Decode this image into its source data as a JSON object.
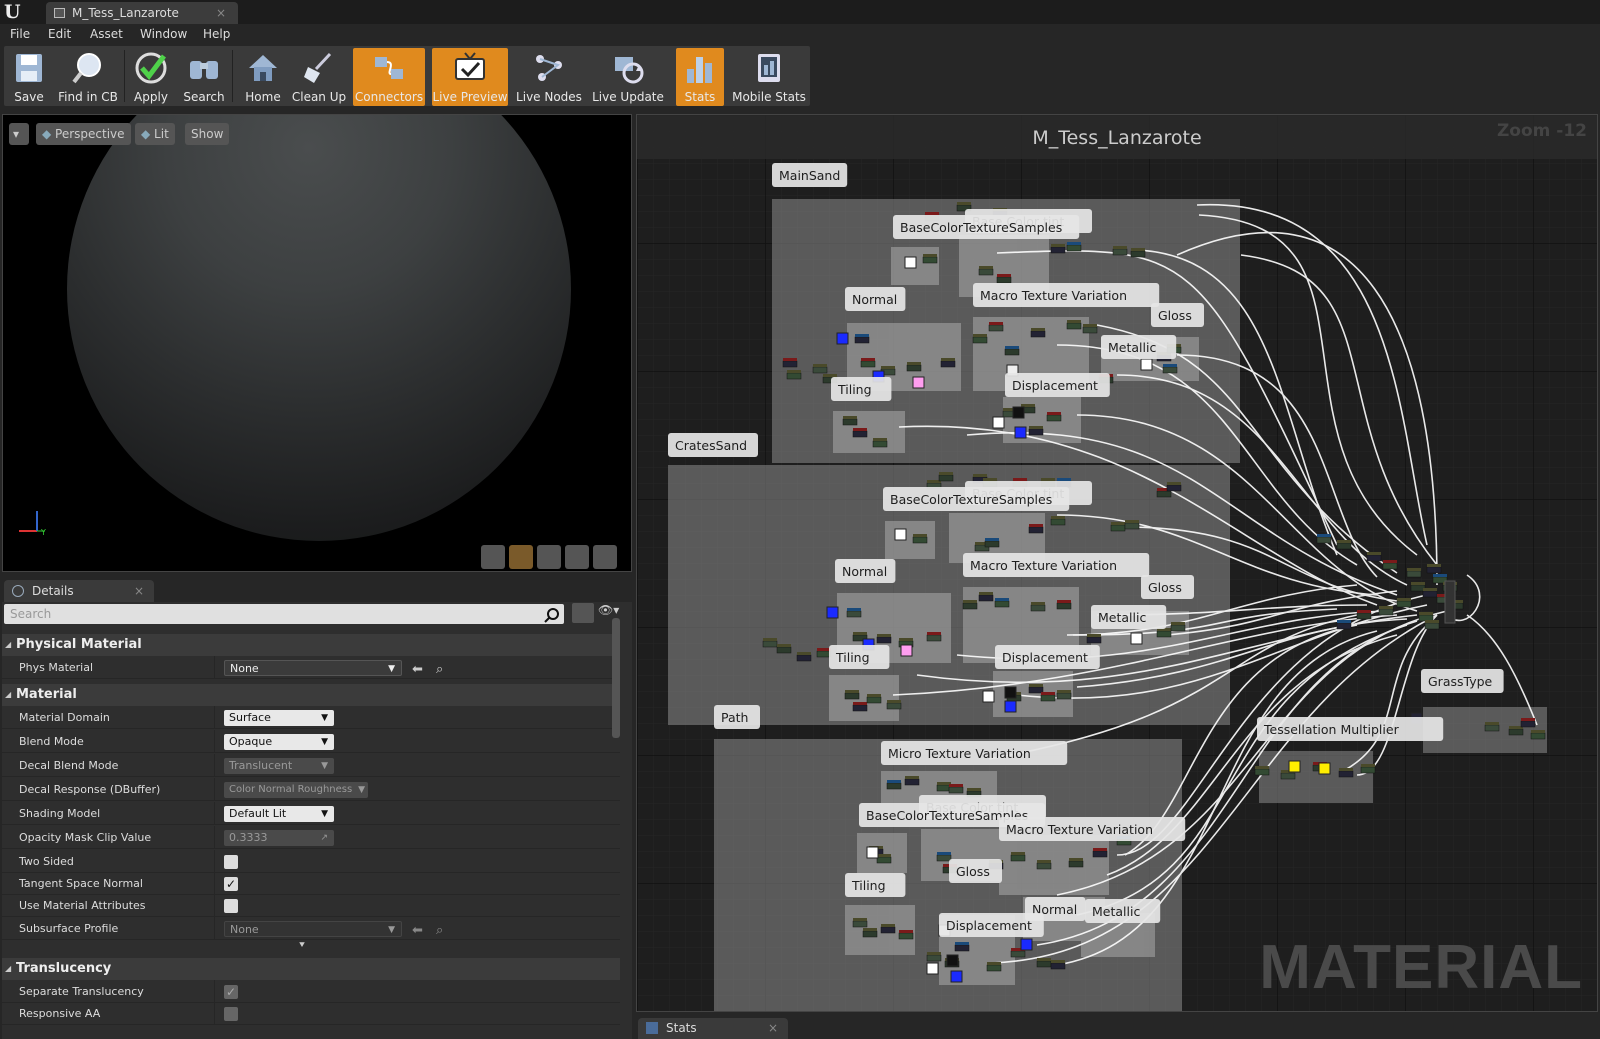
{
  "window": {
    "tab_title": "M_Tess_Lanzarote",
    "tab_close": "×"
  },
  "menu": [
    "File",
    "Edit",
    "Asset",
    "Window",
    "Help"
  ],
  "toolbar": [
    {
      "label": "Save",
      "icon": "save-icon",
      "active": false
    },
    {
      "label": "Find in CB",
      "icon": "magnifier-icon",
      "active": false
    },
    {
      "label": "Apply",
      "icon": "checkmark-icon",
      "active": false
    },
    {
      "label": "Search",
      "icon": "binoculars-icon",
      "active": false
    },
    {
      "label": "Home",
      "icon": "house-icon",
      "active": false
    },
    {
      "label": "Clean Up",
      "icon": "broom-icon",
      "active": false
    },
    {
      "label": "Connectors",
      "icon": "connectors-icon",
      "active": true
    },
    {
      "label": "Live Preview",
      "icon": "tv-icon",
      "active": true
    },
    {
      "label": "Live Nodes",
      "icon": "nodes-icon",
      "active": false
    },
    {
      "label": "Live Update",
      "icon": "refresh-icon",
      "active": false
    },
    {
      "label": "Stats",
      "icon": "bar-chart-icon",
      "active": true
    },
    {
      "label": "Mobile Stats",
      "icon": "mobile-icon",
      "active": false
    }
  ],
  "viewport": {
    "perspective": "Perspective",
    "lit": "Lit",
    "show": "Show"
  },
  "details": {
    "tab_label": "Details",
    "tab_close": "×",
    "search_placeholder": "Search",
    "categories": {
      "physical": "Physical Material",
      "material": "Material",
      "translucency": "Translucency"
    },
    "rows": {
      "phys_material": {
        "label": "Phys Material",
        "value": "None"
      },
      "material_domain": {
        "label": "Material Domain",
        "value": "Surface"
      },
      "blend_mode": {
        "label": "Blend Mode",
        "value": "Opaque"
      },
      "decal_blend_mode": {
        "label": "Decal Blend Mode",
        "value": "Translucent"
      },
      "decal_response": {
        "label": "Decal Response (DBuffer)",
        "value": "Color Normal Roughness"
      },
      "shading_model": {
        "label": "Shading Model",
        "value": "Default Lit"
      },
      "opacity_mask_clip": {
        "label": "Opacity Mask Clip Value",
        "value": "0.3333"
      },
      "two_sided": {
        "label": "Two Sided",
        "checked": false
      },
      "tangent_space_normal": {
        "label": "Tangent Space Normal",
        "checked": true
      },
      "use_material_attributes": {
        "label": "Use Material Attributes",
        "checked": false
      },
      "subsurface_profile": {
        "label": "Subsurface Profile",
        "value": "None"
      },
      "separate_translucency": {
        "label": "Separate Translucency",
        "checked": true
      },
      "responsive_aa": {
        "label": "Responsive AA",
        "checked": false
      }
    }
  },
  "graph": {
    "title": "M_Tess_Lanzarote",
    "zoom": "Zoom -12",
    "watermark": "MATERIAL",
    "comments": [
      "MainSand",
      "Base Color tint",
      "BaseColorTextureSamples",
      "Macro Texture Variation",
      "Normal",
      "Gloss",
      "Metallic",
      "Tiling",
      "Displacement",
      "CratesSand",
      "Base Color tint",
      "BaseColorTextureSamples",
      "Normal",
      "Macro Texture Variation",
      "Gloss",
      "Metallic",
      "Tiling",
      "Displacement",
      "Path",
      "Micro Texture Variation",
      "Base Color tint",
      "BaseColorTextureSamples",
      "Macro Texture Variation",
      "Tiling",
      "Gloss",
      "Normal",
      "Metallic",
      "Displacement",
      "GrassType",
      "Tessellation Multiplier"
    ]
  },
  "stats_tab": {
    "label": "Stats",
    "close": "×"
  },
  "colors": {
    "accent": "#e08a1e",
    "graph_bg": "#1e1e1e",
    "comment_box": "#8a8a8a",
    "wire": "#ffffff"
  }
}
